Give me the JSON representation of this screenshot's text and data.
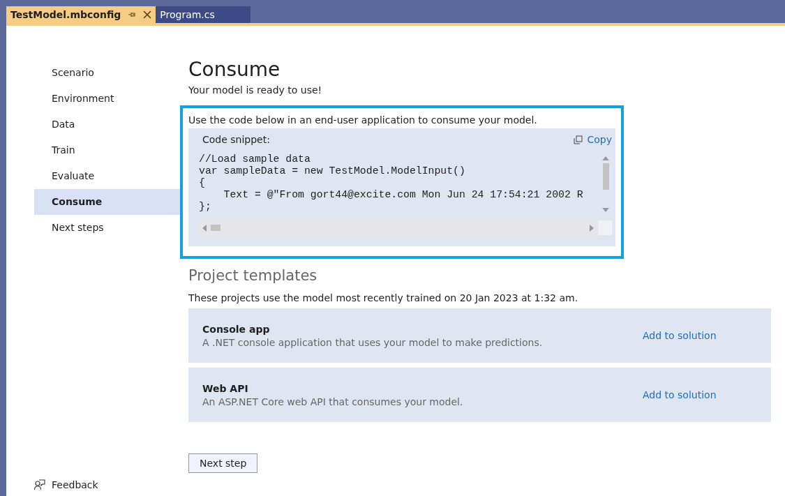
{
  "tabs": [
    {
      "label": "TestModel.mbconfig",
      "selected": true,
      "pinned": true,
      "closable": true
    },
    {
      "label": "Program.cs",
      "selected": false,
      "pinned": false,
      "closable": false
    }
  ],
  "sidebar": {
    "items": [
      {
        "label": "Scenario",
        "selected": false
      },
      {
        "label": "Environment",
        "selected": false
      },
      {
        "label": "Data",
        "selected": false
      },
      {
        "label": "Train",
        "selected": false
      },
      {
        "label": "Evaluate",
        "selected": false
      },
      {
        "label": "Consume",
        "selected": true
      },
      {
        "label": "Next steps",
        "selected": false
      }
    ],
    "feedback": "Feedback"
  },
  "page": {
    "title": "Consume",
    "subtitle": "Your model is ready to use!",
    "code_panel": {
      "intro": "Use the code below in an end-user application to consume your model.",
      "label": "Code snippet:",
      "copy": "Copy",
      "lines": [
        "//Load sample data",
        "var sampleData = new TestModel.ModelInput()",
        "{",
        "    Text = @\"From gort44@excite.com Mon Jun 24 17:54:21 2002 R",
        "};"
      ]
    },
    "templates": {
      "title": "Project templates",
      "intro": "These projects use the model most recently trained on 20 Jan 2023 at 1:32 am.",
      "items": [
        {
          "name": "Console app",
          "description": "A .NET console application that uses your model to make predictions.",
          "action": "Add to solution"
        },
        {
          "name": "Web API",
          "description": "An ASP.NET Core web API that consumes your model.",
          "action": "Add to solution"
        }
      ]
    },
    "next_button": "Next step"
  }
}
